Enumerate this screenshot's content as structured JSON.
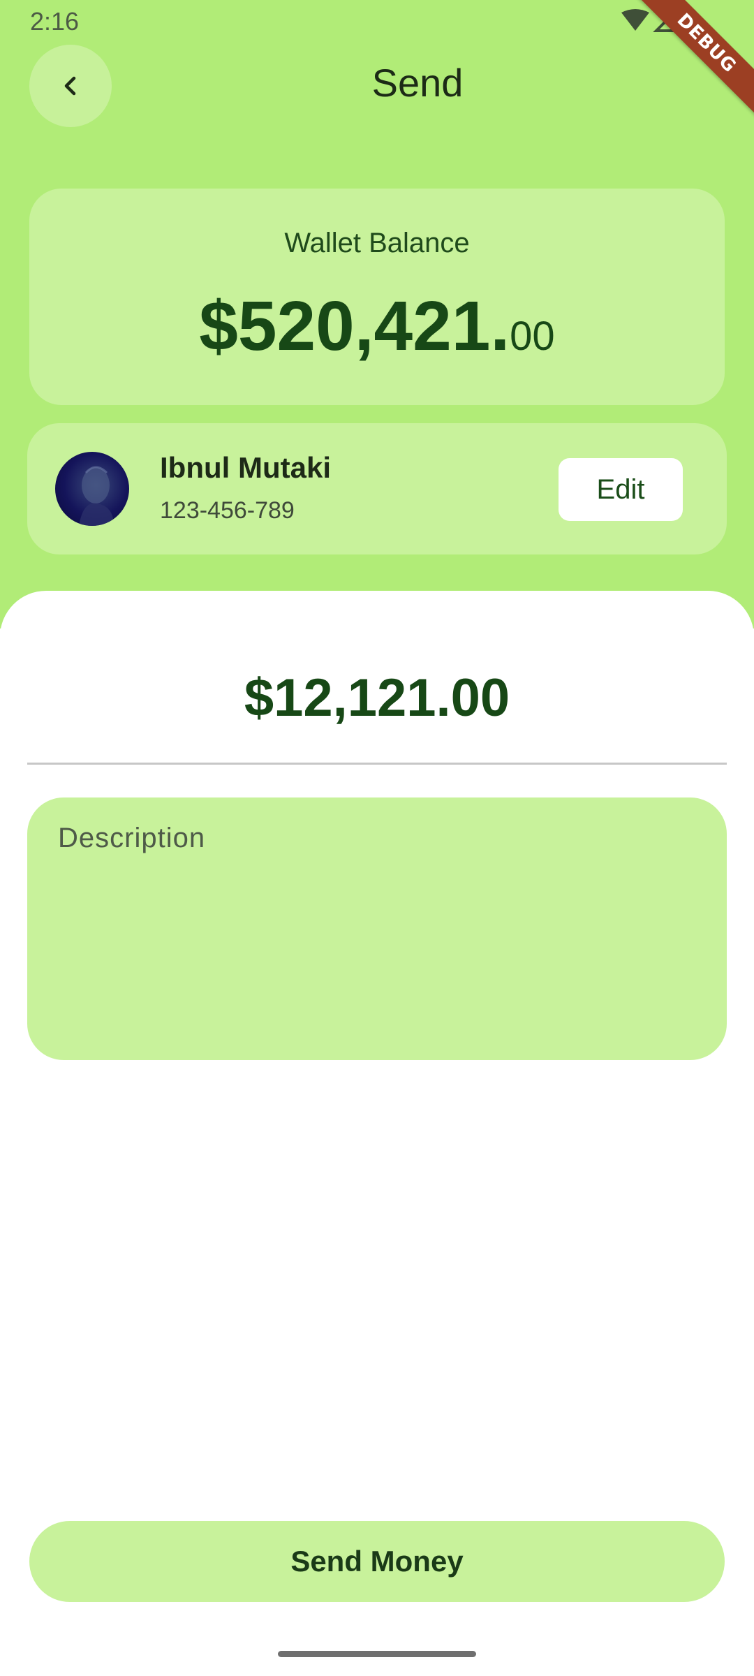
{
  "status_bar": {
    "time": "2:16",
    "icons": [
      "wifi-icon",
      "signal-icon",
      "battery-icon"
    ]
  },
  "debug_banner": "DEBUG",
  "header": {
    "title": "Send",
    "back_icon": "chevron-left-icon"
  },
  "wallet": {
    "label": "Wallet Balance",
    "amount_main": "$520,421.",
    "amount_cents": "00"
  },
  "recipient": {
    "name": "Ibnul Mutaki",
    "account": "123-456-789",
    "edit_label": "Edit"
  },
  "transfer": {
    "amount": "$12,121.00",
    "description_placeholder": "Description"
  },
  "actions": {
    "send_label": "Send Money"
  },
  "colors": {
    "accent_background": "#b1ec77",
    "card_background": "#c8f29b",
    "primary_text": "#174816",
    "debug_ribbon": "#9c3f23"
  }
}
